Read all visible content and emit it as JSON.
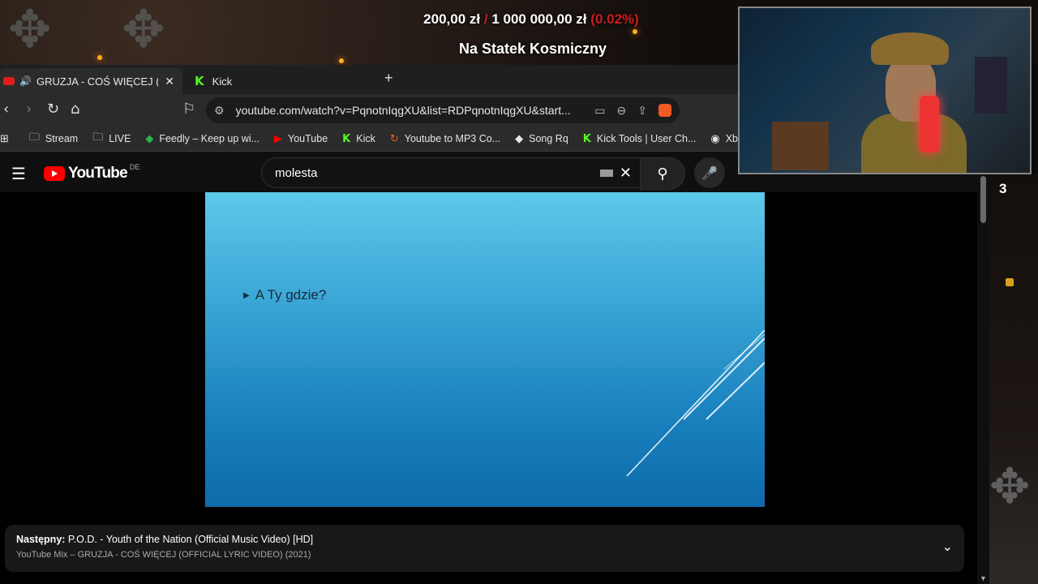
{
  "overlay": {
    "goal_current": "200,00 zł",
    "goal_separator": "/",
    "goal_target": "1 000 000,00 zł",
    "goal_percent": "(0.02%)",
    "goal_title": "Na Statek Kosmiczny",
    "side_number": "3"
  },
  "browser": {
    "tabs": [
      {
        "label": "GRUZJA - COŚ WIĘCEJ (OFFIC",
        "icon": "youtube-icon",
        "active": true
      },
      {
        "label": "Kick",
        "icon": "kick-icon",
        "active": false
      }
    ],
    "url": "youtube.com/watch?v=PqnotnIqgXU&list=RDPqnotnIqgXU&start...",
    "bookmarks": [
      {
        "label": "Stream",
        "icon": "folder-icon"
      },
      {
        "label": "LIVE",
        "icon": "folder-icon"
      },
      {
        "label": "Feedly – Keep up wi...",
        "icon": "feedly-icon"
      },
      {
        "label": "YouTube",
        "icon": "youtube-icon"
      },
      {
        "label": "Kick",
        "icon": "kick-icon"
      },
      {
        "label": "Youtube to MP3 Co...",
        "icon": "converter-icon"
      },
      {
        "label": "Song Rq",
        "icon": "diamond-icon"
      },
      {
        "label": "Kick Tools | User Ch...",
        "icon": "kick-icon"
      },
      {
        "label": "Xbox Cl",
        "icon": "globe-icon"
      }
    ]
  },
  "youtube": {
    "logo_text": "YouTube",
    "region": "DE",
    "search_value": "molesta",
    "video_slide_text": "A Ty gdzie?",
    "upnext_label": "Następny:",
    "upnext_title": "P.O.D. - Youth of the Nation (Official Music Video) [HD]",
    "upnext_sub": "YouTube Mix – GRUZJA - COŚ WIĘCEJ (OFFICIAL LYRIC VIDEO) (2021)"
  },
  "colors": {
    "accent_red": "#c81e1e",
    "youtube_red": "#ff0000",
    "kick_green": "#53fc18"
  }
}
